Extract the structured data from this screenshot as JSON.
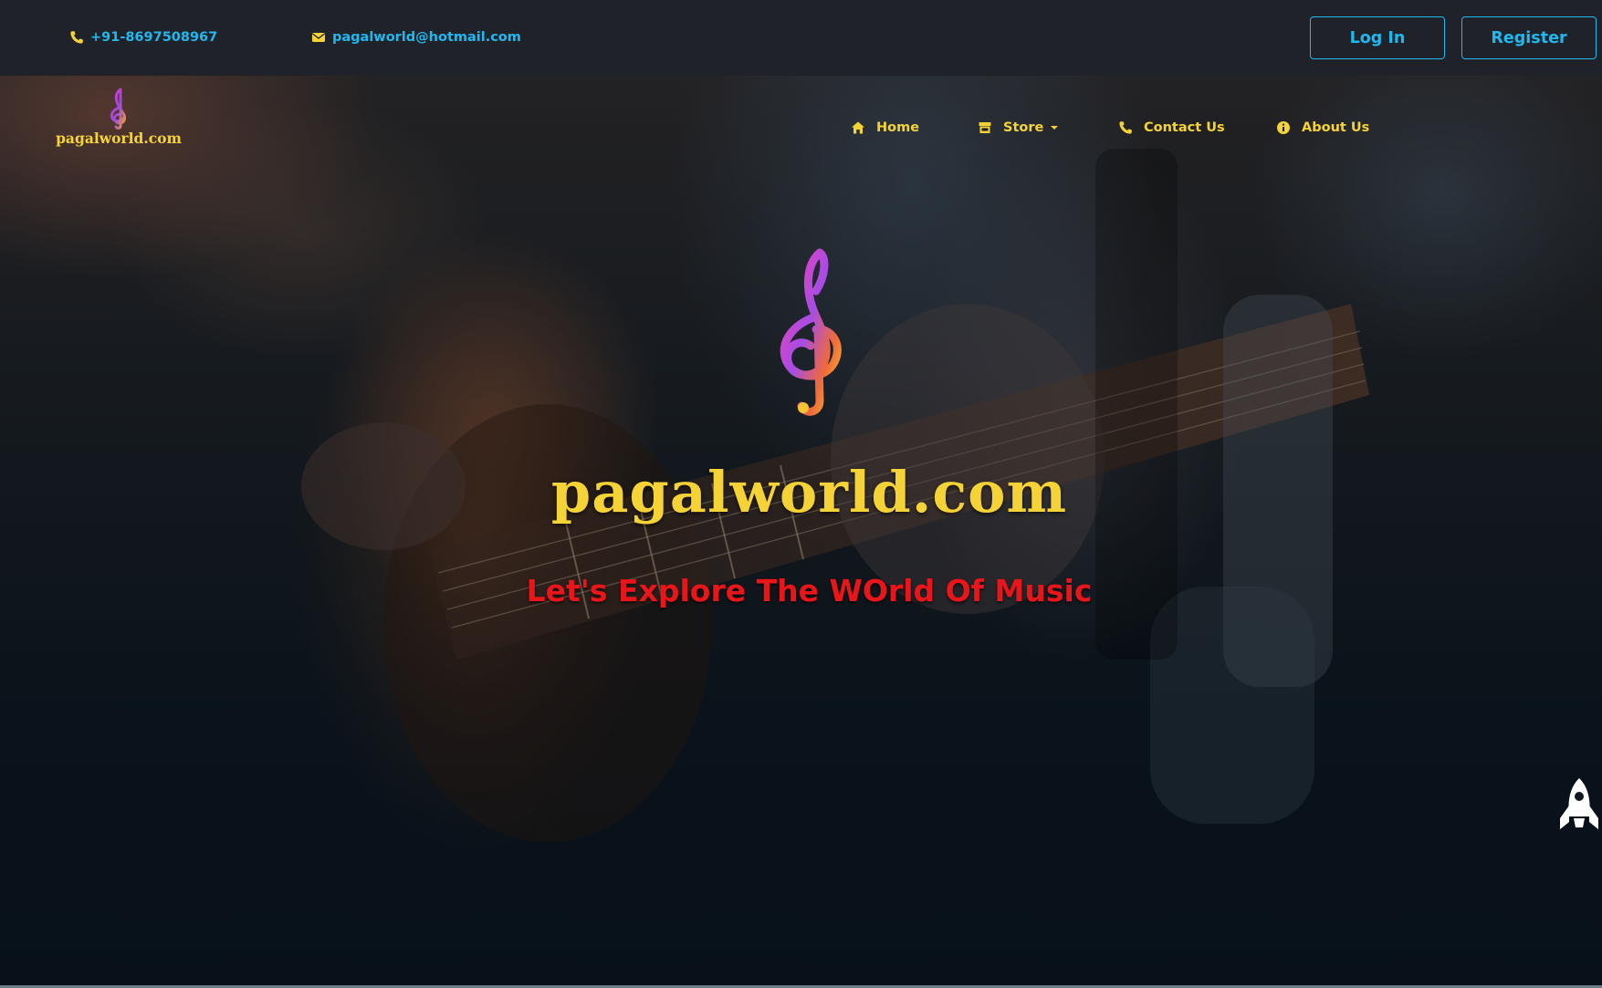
{
  "topbar": {
    "phone": "+91-8697508967",
    "email": "pagalworld@hotmail.com",
    "login_label": "Log In",
    "register_label": "Register"
  },
  "brand": {
    "name": "pagalworld.com",
    "logo_icon": "treble-clef-icon"
  },
  "nav": {
    "items": [
      {
        "label": "Home",
        "icon": "home-icon"
      },
      {
        "label": "Store",
        "icon": "store-icon",
        "dropdown": true
      },
      {
        "label": "Contact Us",
        "icon": "phone-icon"
      },
      {
        "label": "About Us",
        "icon": "info-icon"
      }
    ]
  },
  "hero": {
    "title": "pagalworld.com",
    "tagline": "Let's Explore The WOrld Of Music",
    "background_subject": "guitar player photo"
  },
  "scroll_top_icon": "rocket-icon",
  "colors": {
    "topbar_bg": "#1f2329",
    "accent_blue": "#21b8ef",
    "brand_yellow": "#f5d336",
    "tagline_red": "#e8151a"
  }
}
